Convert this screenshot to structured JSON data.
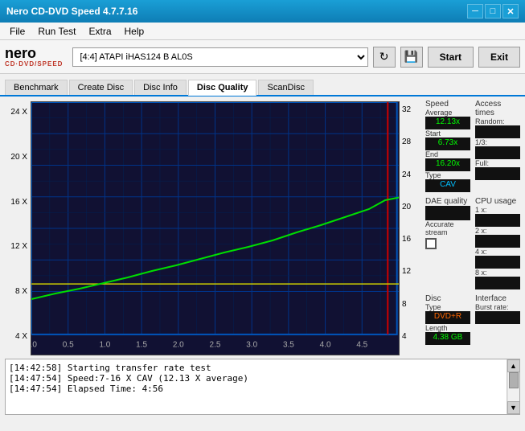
{
  "title_bar": {
    "title": "Nero CD-DVD Speed 4.7.7.16",
    "min_btn": "─",
    "max_btn": "□",
    "close_btn": "✕"
  },
  "menu": {
    "items": [
      "File",
      "Run Test",
      "Extra",
      "Help"
    ]
  },
  "toolbar": {
    "drive_value": "[4:4]  ATAPI iHAS124  B AL0S",
    "start_label": "Start",
    "exit_label": "Exit"
  },
  "tabs": [
    {
      "label": "Benchmark",
      "active": false
    },
    {
      "label": "Create Disc",
      "active": false
    },
    {
      "label": "Disc Info",
      "active": false
    },
    {
      "label": "Disc Quality",
      "active": true
    },
    {
      "label": "ScanDisc",
      "active": false
    }
  ],
  "stats": {
    "speed": {
      "label": "Speed",
      "avg_label": "Average",
      "avg_value": "12.13x",
      "start_label": "Start",
      "start_value": "6.73x",
      "end_label": "End",
      "end_value": "16.20x",
      "type_label": "Type",
      "type_value": "CAV"
    },
    "dae": {
      "label": "DAE quality",
      "value": ""
    },
    "accurate_stream": {
      "label": "Accurate stream"
    },
    "disc": {
      "label": "Disc",
      "type_label": "Type",
      "type_value": "DVD+R",
      "length_label": "Length",
      "length_value": "4.38 GB"
    }
  },
  "access_times": {
    "label": "Access times",
    "random_label": "Random:",
    "random_value": "",
    "one_third_label": "1/3:",
    "one_third_value": "",
    "full_label": "Full:",
    "full_value": ""
  },
  "cpu_usage": {
    "label": "CPU usage",
    "1x_label": "1 x:",
    "1x_value": "",
    "2x_label": "2 x:",
    "2x_value": "",
    "4x_label": "4 x:",
    "4x_value": "",
    "8x_label": "8 x:",
    "8x_value": ""
  },
  "interface": {
    "label": "Interface",
    "burst_label": "Burst rate:",
    "burst_value": ""
  },
  "log": {
    "lines": [
      "[14:42:58]  Starting transfer rate test",
      "[14:47:54]  Speed:7-16 X CAV (12.13 X average)",
      "[14:47:54]  Elapsed Time: 4:56"
    ]
  },
  "chart": {
    "y_left_labels": [
      "24 X",
      "20 X",
      "16 X",
      "12 X",
      "8 X",
      "4 X"
    ],
    "y_right_labels": [
      "32",
      "28",
      "24",
      "20",
      "16",
      "12",
      "8",
      "4"
    ],
    "x_labels": [
      "0.0",
      "0.5",
      "1.0",
      "1.5",
      "2.0",
      "2.5",
      "3.0",
      "3.5",
      "4.0",
      "4.5"
    ]
  },
  "colors": {
    "accent_blue": "#0078d7",
    "title_bar_start": "#1a9fd6",
    "chart_bg": "#1a1a2e",
    "grid_color": "#003366",
    "curve_green": "#00cc00",
    "curve_yellow": "#cccc00",
    "curve_red": "#cc0000",
    "text_green": "#00ff00",
    "text_orange": "#ff6600"
  }
}
